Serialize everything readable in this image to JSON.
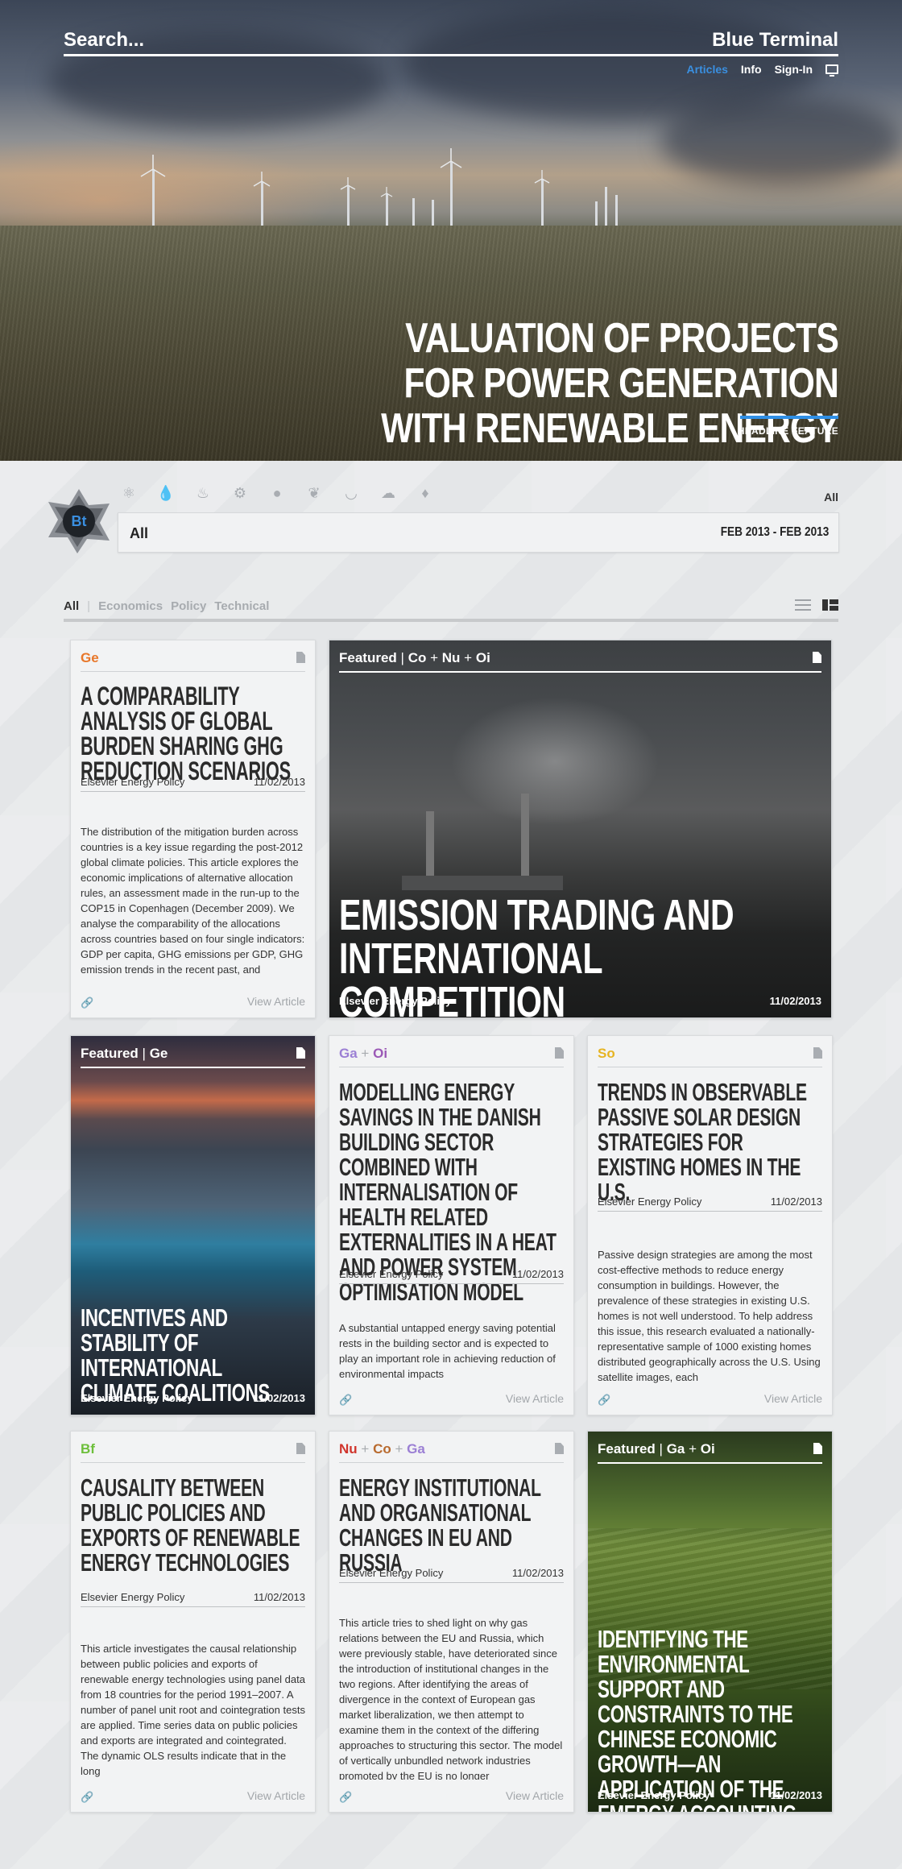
{
  "header": {
    "search_placeholder": "Search...",
    "brand": "Blue Terminal",
    "nav": [
      "Articles",
      "Info",
      "Sign-In"
    ]
  },
  "hero": {
    "title": "VALUATION OF PROJECTS FOR POWER GENERATION WITH RENEWABLE ENERGY",
    "tag": "HEADLINE FEATURE"
  },
  "logo": "Bt",
  "category_icons": [
    "atom-icon",
    "drop-icon",
    "heat-icon",
    "gear-icon",
    "pig-icon",
    "leaf-icon",
    "bowl-icon",
    "cloud-icon",
    "flame-icon"
  ],
  "filter": {
    "all_right": "All",
    "selected": "All",
    "range": "FEB 2013 - FEB 2013"
  },
  "tabs": [
    "All",
    "Economics",
    "Policy",
    "Technical"
  ],
  "colors": {
    "accent": "#2f8fe5",
    "Ge": "#e8772a",
    "Ga": "#9b7fd4",
    "Oi": "#9b59b6",
    "So": "#e6b422",
    "Bf": "#6dbf3b",
    "Nu": "#d0342c",
    "Co": "#b86a2e"
  },
  "cards": [
    {
      "tags": [
        "Ge"
      ],
      "title": "A COMPARABILITY ANALYSIS OF GLOBAL BURDEN SHARING GHG REDUCTION SCENARIOS",
      "source": "Elsevier Energy Policy",
      "date": "11/02/2013",
      "excerpt": "The distribution of the mitigation burden across countries is a key issue regarding the post-2012 global climate policies. This article explores the economic implications of alternative allocation rules, an assessment made in the run-up to the COP15 in Copenhagen (December 2009). We analyse the comparability of the allocations across countries based on four single indicators: GDP per capita, GHG emissions per GDP, GHG emission trends in the recent past, and",
      "view": "View Article"
    },
    {
      "featured_label": "Featured",
      "tags": [
        "Co",
        "Nu",
        "Oi"
      ],
      "title": "EMISSION TRADING AND INTERNATIONAL COMPETITION",
      "source": "Elsevier Energy Policy",
      "date": "11/02/2013"
    },
    {
      "featured_label": "Featured",
      "tags": [
        "Ge"
      ],
      "title": "INCENTIVES AND STABILITY OF INTERNATIONAL CLIMATE COALITIONS",
      "source": "Elsevier Energy Policy",
      "date": "11/02/2013"
    },
    {
      "tags": [
        "Ga",
        "Oi"
      ],
      "title": "MODELLING ENERGY SAVINGS IN THE DANISH BUILDING SECTOR COMBINED WITH INTERNALISATION OF HEALTH RELATED EXTERNALITIES IN A HEAT AND POWER SYSTEM OPTIMISATION MODEL",
      "source": "Elsevier Energy Policy",
      "date": "11/02/2013",
      "excerpt": "A substantial untapped energy saving potential rests in the building sector and is expected to play an important role in achieving reduction of environmental impacts",
      "view": "View Article"
    },
    {
      "tags": [
        "So"
      ],
      "title": "TRENDS IN OBSERVABLE PASSIVE SOLAR DESIGN STRATEGIES FOR EXISTING HOMES IN THE U.S.",
      "source": "Elsevier Energy Policy",
      "date": "11/02/2013",
      "excerpt": "Passive design strategies are among the most cost-effective methods to reduce energy consumption in buildings. However, the prevalence of these strategies in existing U.S. homes is not well understood. To help address this issue, this research evaluated a nationally-representative sample of 1000 existing homes distributed geographically across the U.S. Using satellite images, each",
      "view": "View Article"
    },
    {
      "tags": [
        "Bf"
      ],
      "title": "CAUSALITY BETWEEN PUBLIC POLICIES AND EXPORTS OF RENEWABLE ENERGY TECHNOLOGIES",
      "source": "Elsevier Energy Policy",
      "date": "11/02/2013",
      "excerpt": "This article investigates the causal relationship between public policies and exports of renewable energy technologies using panel data from 18 countries for the period 1991–2007. A number of panel unit root and cointegration tests are applied. Time series data on public policies and exports are integrated and cointegrated. The dynamic OLS results indicate that in the long",
      "view": "View Article"
    },
    {
      "tags": [
        "Nu",
        "Co",
        "Ga"
      ],
      "title": "ENERGY INSTITUTIONAL AND ORGANISATIONAL CHANGES IN EU AND RUSSIA",
      "source": "Elsevier Energy Policy",
      "date": "11/02/2013",
      "excerpt": "This article tries to shed light on why gas relations between the EU and Russia, which were previously stable, have deteriorated since the introduction of institutional changes in the two regions. After identifying the areas of divergence in the context of European gas market liberalization, we then attempt to examine them in the context of the differing approaches to structuring this sector. The model of vertically unbundled network industries promoted by the EU is no longer",
      "view": "View Article"
    },
    {
      "featured_label": "Featured",
      "tags": [
        "Ga",
        "Oi"
      ],
      "title": "IDENTIFYING THE ENVIRONMENTAL SUPPORT AND CONSTRAINTS TO THE CHINESE ECONOMIC GROWTH—AN APPLICATION OF THE EMERGY ACCOUNTING METHOD",
      "source": "Elsevier Energy Policy",
      "date": "11/02/2013"
    }
  ]
}
